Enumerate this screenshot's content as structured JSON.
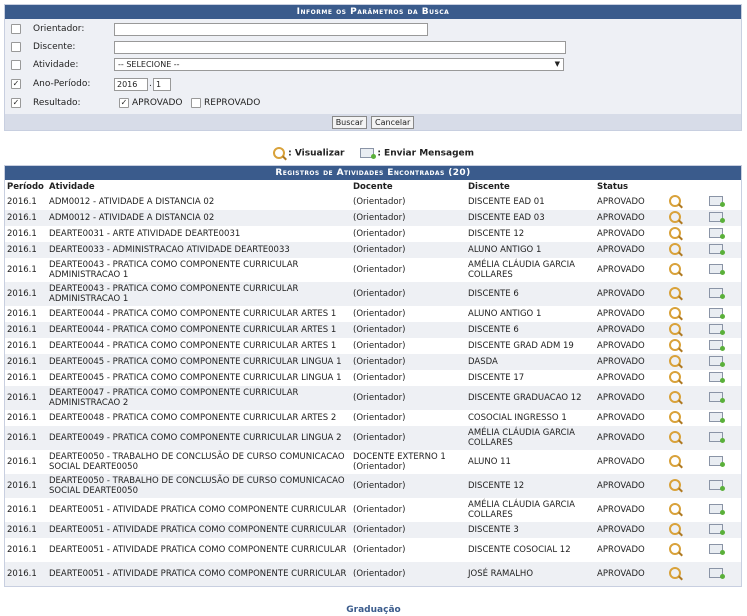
{
  "search": {
    "title": "Informe os Parâmetros da Busca",
    "fields": [
      {
        "label": "Orientador:",
        "checked": false
      },
      {
        "label": "Discente:",
        "checked": false
      },
      {
        "label": "Atividade:",
        "checked": false,
        "value": "-- SELECIONE --"
      },
      {
        "label": "Ano-Período:",
        "checked": true,
        "year": "2016",
        "period": "1"
      },
      {
        "label": "Resultado:",
        "checked": true
      }
    ],
    "result_opts": [
      {
        "label": "APROVADO",
        "checked": true
      },
      {
        "label": "REPROVADO",
        "checked": false
      }
    ],
    "buttons": {
      "search": "Buscar",
      "cancel": "Cancelar"
    }
  },
  "legend": {
    "view": ": Visualizar",
    "send": ": Enviar Mensagem"
  },
  "results": {
    "title": "Registros de Atividades Encontradas (20)",
    "columns": [
      "Período",
      "Atividade",
      "Docente",
      "Discente",
      "Status"
    ],
    "rows": [
      {
        "periodo": "2016.1",
        "atividade": "ADM0012 - ATIVIDADE A DISTANCIA 02",
        "docente": "(Orientador)",
        "discente": "DISCENTE EAD 01",
        "status": "APROVADO"
      },
      {
        "periodo": "2016.1",
        "atividade": "ADM0012 - ATIVIDADE A DISTANCIA 02",
        "docente": "(Orientador)",
        "discente": "DISCENTE EAD 03",
        "status": "APROVADO"
      },
      {
        "periodo": "2016.1",
        "atividade": "DEARTE0031 - ARTE ATIVIDADE DEARTE0031",
        "docente": "(Orientador)",
        "discente": "DISCENTE 12",
        "status": "APROVADO"
      },
      {
        "periodo": "2016.1",
        "atividade": "DEARTE0033 - ADMINISTRACAO ATIVIDADE DEARTE0033",
        "docente": "(Orientador)",
        "discente": "ALUNO ANTIGO 1",
        "status": "APROVADO"
      },
      {
        "periodo": "2016.1",
        "atividade": "DEARTE0043 - PRATICA COMO COMPONENTE CURRICULAR ADMINISTRACAO 1",
        "docente": "(Orientador)",
        "discente": "AMÉLIA CLÁUDIA GARCIA COLLARES",
        "status": "APROVADO"
      },
      {
        "periodo": "2016.1",
        "atividade": "DEARTE0043 - PRATICA COMO COMPONENTE CURRICULAR ADMINISTRACAO 1",
        "docente": "(Orientador)",
        "discente": "DISCENTE 6",
        "status": "APROVADO"
      },
      {
        "periodo": "2016.1",
        "atividade": "DEARTE0044 - PRATICA COMO COMPONENTE CURRICULAR ARTES 1",
        "docente": "(Orientador)",
        "discente": "ALUNO ANTIGO 1",
        "status": "APROVADO"
      },
      {
        "periodo": "2016.1",
        "atividade": "DEARTE0044 - PRATICA COMO COMPONENTE CURRICULAR ARTES 1",
        "docente": "(Orientador)",
        "discente": "DISCENTE 6",
        "status": "APROVADO"
      },
      {
        "periodo": "2016.1",
        "atividade": "DEARTE0044 - PRATICA COMO COMPONENTE CURRICULAR ARTES 1",
        "docente": "(Orientador)",
        "discente": "DISCENTE GRAD ADM 19",
        "status": "APROVADO"
      },
      {
        "periodo": "2016.1",
        "atividade": "DEARTE0045 - PRATICA COMO COMPONENTE CURRICULAR LINGUA 1",
        "docente": "(Orientador)",
        "discente": "DASDA",
        "status": "APROVADO"
      },
      {
        "periodo": "2016.1",
        "atividade": "DEARTE0045 - PRATICA COMO COMPONENTE CURRICULAR LINGUA 1",
        "docente": "(Orientador)",
        "discente": "DISCENTE 17",
        "status": "APROVADO"
      },
      {
        "periodo": "2016.1",
        "atividade": "DEARTE0047 - PRATICA COMO COMPONENTE CURRICULAR ADMINISTRACAO 2",
        "docente": "(Orientador)",
        "discente": "DISCENTE GRADUACAO 12",
        "status": "APROVADO"
      },
      {
        "periodo": "2016.1",
        "atividade": "DEARTE0048 - PRATICA COMO COMPONENTE CURRICULAR ARTES 2",
        "docente": "(Orientador)",
        "discente": "COSOCIAL INGRESSO 1",
        "status": "APROVADO"
      },
      {
        "periodo": "2016.1",
        "atividade": "DEARTE0049 - PRATICA COMO COMPONENTE CURRICULAR LINGUA 2",
        "docente": "(Orientador)",
        "discente": "AMÉLIA CLÁUDIA GARCIA COLLARES",
        "status": "APROVADO"
      },
      {
        "periodo": "2016.1",
        "atividade": "DEARTE0050 - TRABALHO DE CONCLUSÃO DE CURSO COMUNICACAO SOCIAL DEARTE0050",
        "docente": "DOCENTE EXTERNO 1 (Orientador)",
        "discente": "ALUNO 11",
        "status": "APROVADO"
      },
      {
        "periodo": "2016.1",
        "atividade": "DEARTE0050 - TRABALHO DE CONCLUSÃO DE CURSO COMUNICACAO SOCIAL DEARTE0050",
        "docente": "(Orientador)",
        "discente": "DISCENTE 12",
        "status": "APROVADO"
      },
      {
        "periodo": "2016.1",
        "atividade": "DEARTE0051 - ATIVIDADE PRATICA COMO COMPONENTE CURRICULAR",
        "docente": "(Orientador)",
        "discente": "AMÉLIA CLÁUDIA GARCIA COLLARES",
        "status": "APROVADO"
      },
      {
        "periodo": "2016.1",
        "atividade": "DEARTE0051 - ATIVIDADE PRATICA COMO COMPONENTE CURRICULAR",
        "docente": "(Orientador)",
        "discente": "DISCENTE 3",
        "status": "APROVADO"
      },
      {
        "periodo": "2016.1",
        "atividade": "DEARTE0051 - ATIVIDADE PRATICA COMO COMPONENTE CURRICULAR",
        "docente": "(Orientador)",
        "discente": "DISCENTE COSOCIAL 12",
        "status": "APROVADO"
      },
      {
        "periodo": "2016.1",
        "atividade": "DEARTE0051 - ATIVIDADE PRATICA COMO COMPONENTE CURRICULAR",
        "docente": "(Orientador)",
        "discente": "JOSÉ RAMALHO",
        "status": "APROVADO"
      }
    ]
  },
  "footer": {
    "link": "Graduação"
  }
}
